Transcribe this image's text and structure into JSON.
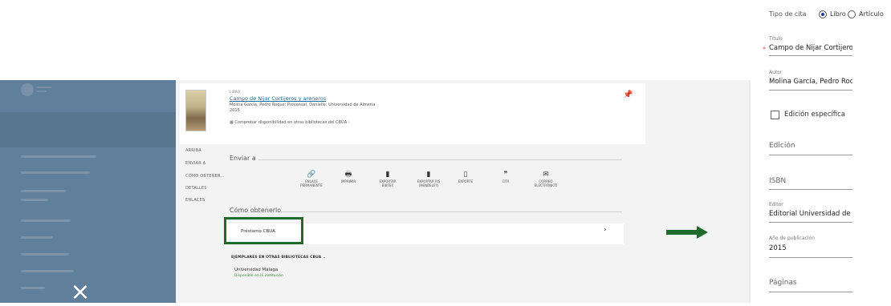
{
  "sidebar": {
    "close_label": "×"
  },
  "record": {
    "type": "LIBRO",
    "title": "Campo de Nijar Cortijeros y areneros",
    "authors": "Molina García, Pedro Roque; Provensal, Danielle; Universidad de Almería",
    "year": "2015",
    "availability_link": "Comprobar disponibilidad en otras bibliotecas del CBUA  ›"
  },
  "nav": {
    "items": [
      "ARRIBA",
      "ENVIAR A",
      "CÓMO OBTENER...",
      "DETALLES",
      "ENLACES"
    ]
  },
  "send": {
    "heading": "Enviar a",
    "actions": [
      {
        "label": "ENLACE\nPERMANENTE",
        "icon": "link-icon"
      },
      {
        "label": "IMPRIMIR",
        "icon": "print-icon"
      },
      {
        "label": "EXPORTAR\nBIBTEX",
        "icon": "file-export-icon"
      },
      {
        "label": "EXPORTAR RIS\n(MENDELEY)",
        "icon": "file-export-icon"
      },
      {
        "label": "EXPORTE",
        "icon": "document-icon"
      },
      {
        "label": "CITA",
        "icon": "quote-icon"
      },
      {
        "label": "CORREO\nELECTRÓNICO",
        "icon": "mail-icon"
      }
    ]
  },
  "obtain": {
    "heading": "Cómo obtenerlo",
    "loan": "Préstamo CBUA",
    "chevron": "›",
    "other_libraries": "EJEMPLARES EN OTRAS BIBLIOTECAS CBUA",
    "library_name": "Universidad Málaga",
    "library_status": "Disponible en la institución"
  },
  "form": {
    "citation_type_label": "Tipo de cita",
    "options": [
      "Libro",
      "Artículo"
    ],
    "selected": "Libro",
    "title_label": "Título",
    "title_value": "Campo de Nijar Cortijeros",
    "author_label": "Autor",
    "author_value": "Molina García, Pedro Roq",
    "specific_edition": "Edición específica",
    "edition_placeholder": "Edición",
    "isbn_placeholder": "ISBN",
    "publisher_label": "Editor",
    "publisher_value": "Editorial Universidad de A",
    "year_label": "Año de publicación",
    "year_value": "2015",
    "pages_placeholder": "Páginas"
  },
  "colors": {
    "highlight": "#1f6b2d",
    "arrow": "#1f6b2d",
    "link": "#1d6a8f",
    "sidebar": "#5f7f9b"
  }
}
